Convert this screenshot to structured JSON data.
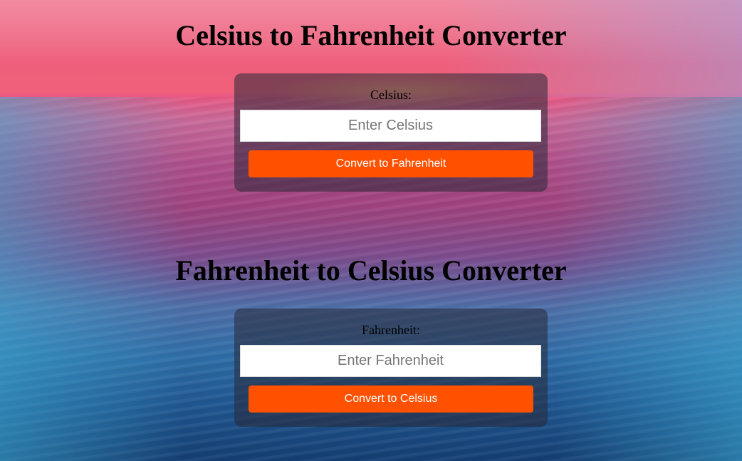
{
  "celsius_section": {
    "heading": "Celsius to Fahrenheit Converter",
    "label": "Celsius:",
    "input_placeholder": "Enter Celsius",
    "input_value": "",
    "button_label": "Convert to Fahrenheit"
  },
  "fahrenheit_section": {
    "heading": "Fahrenheit to Celsius Converter",
    "label": "Fahrenheit:",
    "input_placeholder": "Enter Fahrenheit",
    "input_value": "",
    "button_label": "Convert to Celsius"
  },
  "colors": {
    "button": "#ff5100",
    "card": "rgba(40,40,55,0.55)",
    "heading": "#000000"
  }
}
